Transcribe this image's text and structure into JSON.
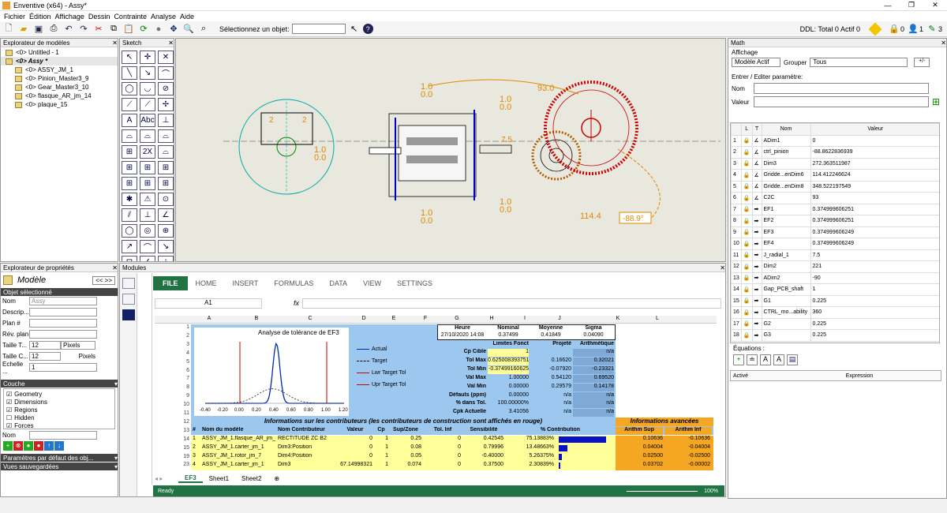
{
  "window": {
    "title": "Enventive (x64) - Assy*",
    "min": "—",
    "max": "❐",
    "close": "✕"
  },
  "menu": [
    "Fichier",
    "Édition",
    "Affichage",
    "Dessin",
    "Contrainte",
    "Analyse",
    "Aide"
  ],
  "toolbar": {
    "select_label": "Sélectionnez un objet:",
    "ddl": "DDL: Total 0 Actif 0",
    "c0": "0",
    "c1": "1",
    "c3": "3"
  },
  "model_explorer": {
    "title": "Explorateur de modèles",
    "items": [
      {
        "label": "<0> Untitled - 1",
        "indent": 0,
        "bold": false
      },
      {
        "label": "<0> Assy *",
        "indent": 0,
        "bold": true
      },
      {
        "label": "<0> ASSY_JM_1",
        "indent": 1,
        "bold": false
      },
      {
        "label": "<0> Pinion_Master3_9",
        "indent": 1,
        "bold": false
      },
      {
        "label": "<0> Gear_Master3_10",
        "indent": 1,
        "bold": false
      },
      {
        "label": "<0> flasque_AR_jm_14",
        "indent": 1,
        "bold": false
      },
      {
        "label": "<0> plaque_15",
        "indent": 1,
        "bold": false
      }
    ]
  },
  "sketch": {
    "title": "Sketch",
    "tools": [
      "↖",
      "✛",
      "✕",
      "╲",
      "↘",
      "⌒",
      "◯",
      "◡",
      "⊘",
      "⟋",
      "⟋",
      "✢",
      "A",
      "Abc",
      "⊥",
      "⌓",
      "⌓",
      "⌓",
      "⊞",
      "2X",
      "⌓",
      "⊞",
      "⊞",
      "⊞",
      "⊞",
      "⊞",
      "⊞",
      "✱",
      "⚠",
      "⊙",
      "⫽",
      "⊥",
      "∠",
      "◯",
      "◎",
      "⊕",
      "↗",
      "⌒",
      "↘",
      "⊟",
      "∠",
      "⊥"
    ]
  },
  "drawing": {
    "dims": [
      "1.0",
      "0.0",
      "1.0",
      "0.0",
      "1.0",
      "0.0",
      "1.0",
      "0.0",
      "1.0",
      "0.0",
      "93.0",
      "114.4",
      "-88.9°",
      "7.5",
      "2",
      "2"
    ]
  },
  "math": {
    "title": "Math",
    "affichage": "Affichage",
    "modele": "Modèle Actif",
    "grouper": "Grouper",
    "tous": "Tous",
    "param_title": "Entrer / Editer paramètre:",
    "nom": "Nom",
    "valeur": "Valeur",
    "headers": {
      "l": "L",
      "t": "T",
      "nom": "Nom",
      "valeur": "Valeur"
    },
    "rows": [
      {
        "n": "1",
        "name": "ADim1",
        "val": "0"
      },
      {
        "n": "2",
        "name": "ctrl_pinion",
        "val": "-88.8622836939"
      },
      {
        "n": "3",
        "name": "Dim3",
        "val": "272.363511987"
      },
      {
        "n": "4",
        "name": "Gridde...enDim6",
        "val": "114.412246624"
      },
      {
        "n": "5",
        "name": "Gridde...enDim8",
        "val": "348.522197549"
      },
      {
        "n": "6",
        "name": "C2C",
        "val": "93"
      },
      {
        "n": "7",
        "name": "EF1",
        "val": "0.374999606251"
      },
      {
        "n": "8",
        "name": "EF2",
        "val": "0.374999606251"
      },
      {
        "n": "9",
        "name": "EF3",
        "val": "0.374999606249"
      },
      {
        "n": "10",
        "name": "EF4",
        "val": "0.374999606249"
      },
      {
        "n": "11",
        "name": "J_radial_1",
        "val": "7.5"
      },
      {
        "n": "12",
        "name": "Dim2",
        "val": "221"
      },
      {
        "n": "13",
        "name": "ADim2",
        "val": "-90"
      },
      {
        "n": "14",
        "name": "Gap_PCB_shaft",
        "val": "1"
      },
      {
        "n": "15",
        "name": "G1",
        "val": "0.225"
      },
      {
        "n": "16",
        "name": "CTRL_mo...ability",
        "val": "360"
      },
      {
        "n": "17",
        "name": "G2",
        "val": "0.225"
      },
      {
        "n": "18",
        "name": "G3",
        "val": "0.225"
      }
    ],
    "equations": "Équations :",
    "actif": "Activé",
    "expression": "Expression"
  },
  "props": {
    "title": "Explorateur de propriétés",
    "model": "Modèle",
    "nav": "<<  >>",
    "selected": "Objet sélectionné",
    "fields": [
      {
        "label": "Nom",
        "value": "Assy"
      },
      {
        "label": "Descrip...",
        "value": ""
      },
      {
        "label": "Plan #",
        "value": ""
      },
      {
        "label": "Rév. plan",
        "value": ""
      }
    ],
    "taille_t": "Taille T...",
    "taille_t_val": "12",
    "pixels": "Pixels",
    "taille_c": "Taille C...",
    "taille_c_val": "12",
    "pixels2": "Pixels",
    "echelle": "Echelle ...",
    "echelle_val": "1",
    "couche": "Couche",
    "layers": [
      {
        "name": "Geometry",
        "checked": true
      },
      {
        "name": "Dimensions",
        "checked": true
      },
      {
        "name": "Regions",
        "checked": true
      },
      {
        "name": "Hidden",
        "checked": false
      },
      {
        "name": "Forces",
        "checked": true
      }
    ],
    "nom2": "Nom",
    "defaults": "Paramètres par défaut des obj...",
    "saved": "Vues sauvegardées"
  },
  "modules": {
    "title": "Modules",
    "ribbon": [
      "FILE",
      "HOME",
      "INSERT",
      "FORMULAS",
      "DATA",
      "VIEW",
      "SETTINGS"
    ],
    "cellref": "A1",
    "fx": "fx",
    "cols": [
      "A",
      "B",
      "C",
      "D",
      "E",
      "F",
      "G",
      "H",
      "I",
      "J",
      "K",
      "L"
    ],
    "rownums": [
      "1",
      "2",
      "3",
      "4",
      "5",
      "6",
      "7",
      "8",
      "9",
      "10",
      "11",
      "12",
      "13",
      "14",
      "15",
      "19",
      "23"
    ],
    "chart_title": "Analyse de tolérance de EF3",
    "legend": [
      "Actual",
      "Target",
      "Lwr Target Tol",
      "Upr Target Tol"
    ],
    "xticks": [
      "-0.40",
      "-0.20",
      "0.00",
      "0.20",
      "0.40",
      "0.60",
      "0.80",
      "1.00",
      "1.20"
    ],
    "stats_head": [
      "Heure",
      "Nominal",
      "Moyenne",
      "Sigma"
    ],
    "stats_vals": [
      "27/10/2020 14:08",
      "0.37499",
      "0.41849",
      "0.04090"
    ],
    "sub_head": [
      "Limites Fonct",
      "Projeté",
      "Arithmétique"
    ],
    "stat_rows": [
      {
        "label": "Cp Cible",
        "a": "1",
        "b": "",
        "c": "n/a"
      },
      {
        "label": "Tol Max",
        "a": "0.625008393751",
        "b": "0.16620",
        "c": "0.32021"
      },
      {
        "label": "Tol Min",
        "a": "-0.37499160625",
        "b": "-0.07920",
        "c": "-0.23321"
      },
      {
        "label": "Val Max",
        "a": "1.00000",
        "b": "0.54120",
        "c": "0.69520"
      },
      {
        "label": "Val Min",
        "a": "0.00000",
        "b": "0.29579",
        "c": "0.14178"
      },
      {
        "label": "Défauts (ppm)",
        "a": "0.00000",
        "b": "n/a",
        "c": "n/a"
      },
      {
        "label": "% dans Tol.",
        "a": "100.00000%",
        "b": "n/a",
        "c": "n/a"
      },
      {
        "label": "Cpk Actuelle",
        "a": "3.41056",
        "b": "n/a",
        "c": "n/a"
      }
    ],
    "contrib_title": "Informations sur les contributeurs (les contributeurs de construction sont affichés en rouge)",
    "adv_title": "Informations avancées",
    "contrib_head": [
      "#",
      "Nom du modèle",
      "Nom Contributeur",
      "Valeur",
      "Cp",
      "Sup/Zone",
      "Tol. Inf",
      "Sensibilité",
      "% Contribution",
      "Arithm Sup",
      "Arithm Inf"
    ],
    "contrib_rows": [
      {
        "n": "1",
        "model": "ASSY_JM_1.flasque_AR_jm_",
        "contrib": "RECTITUDE ZC B2",
        "val": "0",
        "cp": "1",
        "sup": "0.25",
        "inf": "0",
        "sens": "0.42545",
        "pct": "75.13883%",
        "pctv": 75.1,
        "as": "0.10636",
        "ai": "-0.10636"
      },
      {
        "n": "2",
        "model": "ASSY_JM_1.carter_jm_1",
        "contrib": "Dim3:Position",
        "val": "0",
        "cp": "1",
        "sup": "0.08",
        "inf": "0",
        "sens": "0.79996",
        "pct": "13.48663%",
        "pctv": 13.5,
        "as": "0.04004",
        "ai": "-0.04004"
      },
      {
        "n": "3",
        "model": "ASSY_JM_1.rotor_jm_7",
        "contrib": "Dim4:Position",
        "val": "0",
        "cp": "1",
        "sup": "0.05",
        "inf": "0",
        "sens": "-0.40000",
        "pct": "5.26375%",
        "pctv": 5.3,
        "as": "0.02500",
        "ai": "-0.02500"
      },
      {
        "n": "4",
        "model": "ASSY_JM_1.carter_jm_1",
        "contrib": "Dim3",
        "val": "67.14998321",
        "cp": "1",
        "sup": "0.074",
        "inf": "0",
        "sens": "0.37500",
        "pct": "2.30839%",
        "pctv": 2.3,
        "as": "0.03702",
        "ai": "-0.00002"
      }
    ],
    "sheets": [
      "EF3",
      "Sheet1",
      "Sheet2"
    ],
    "status": "Ready",
    "zoom": "100%"
  },
  "colors": {
    "blue_panel": "#9cc8f0",
    "yellow": "#ffff99",
    "orange": "#f5a623",
    "navy": "#203864",
    "drawing_bg": "#e8e8de"
  }
}
